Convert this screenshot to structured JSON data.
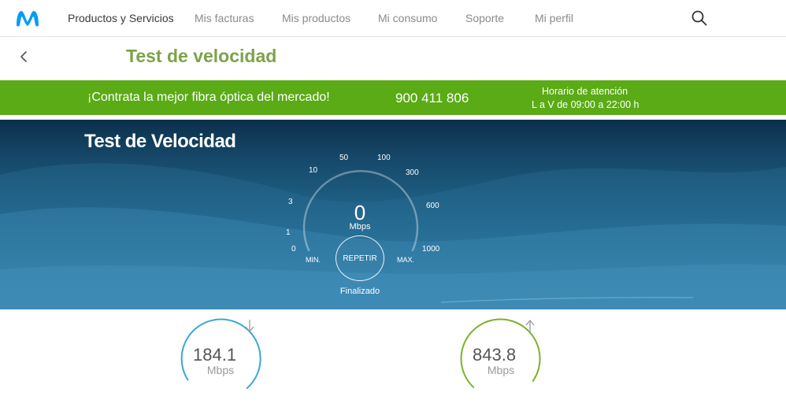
{
  "nav": {
    "items": [
      {
        "label": "Productos y Servicios",
        "active": true
      },
      {
        "label": "Mis facturas",
        "active": false
      },
      {
        "label": "Mis productos",
        "active": false
      },
      {
        "label": "Mi consumo",
        "active": false
      },
      {
        "label": "Soporte",
        "active": false
      },
      {
        "label": "Mi perfil",
        "active": false
      }
    ],
    "search_icon": "search-icon",
    "logo_icon": "movistar-m-logo"
  },
  "page": {
    "back_icon": "chevron-left-icon",
    "title": "Test de velocidad"
  },
  "promo": {
    "text": "¡Contrata la mejor fibra óptica del mercado!",
    "phone": "900 411 806",
    "hours_label": "Horario de atención",
    "hours": "L a V de 09:00 a 22:00 h",
    "color": "#5aab16"
  },
  "test": {
    "title": "Test de Velocidad",
    "ticks": [
      "0",
      "1",
      "3",
      "10",
      "50",
      "100",
      "300",
      "600",
      "1000"
    ],
    "min_label": "MIN.",
    "max_label": "MAX.",
    "value": "0",
    "unit": "Mbps",
    "repeat_label": "REPETIR",
    "status": "Finalizado"
  },
  "results": {
    "download": {
      "value": "184.1",
      "unit": "Mbps",
      "icon": "arrow-down-icon",
      "color": "#3aa6d6"
    },
    "upload": {
      "value": "843.8",
      "unit": "Mbps",
      "icon": "arrow-up-icon",
      "color": "#7bb12a"
    }
  },
  "colors": {
    "brand_blue": "#019df4",
    "title_green": "#7da24a"
  }
}
